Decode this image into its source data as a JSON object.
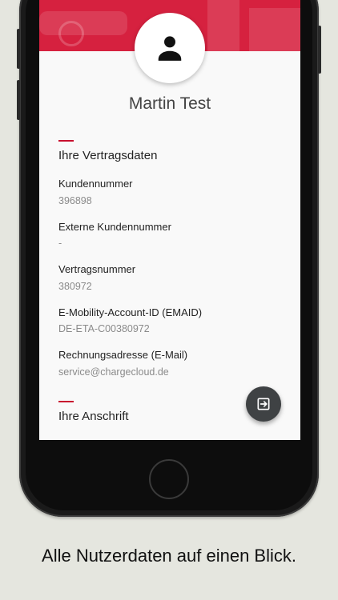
{
  "profile": {
    "name": "Martin Test"
  },
  "contract_section": {
    "title": "Ihre Vertragsdaten",
    "fields": [
      {
        "label": "Kundennummer",
        "value": "396898"
      },
      {
        "label": "Externe Kundennummer",
        "value": "-"
      },
      {
        "label": "Vertragsnummer",
        "value": "380972"
      },
      {
        "label": "E-Mobility-Account-ID (EMAID)",
        "value": "DE-ETA-C00380972"
      },
      {
        "label": "Rechnungsadresse (E-Mail)",
        "value": "service@chargecloud.de"
      }
    ]
  },
  "address_section": {
    "title": "Ihre Anschrift"
  },
  "icons": {
    "avatar": "person-icon",
    "fab": "logout-icon"
  },
  "colors": {
    "brand_red": "#d6213f",
    "accent_red": "#c8102e",
    "fab_dark": "#3f4244",
    "background": "#e5e6df"
  },
  "caption": {
    "text": "Alle Nutzerdaten auf einen Blick."
  }
}
